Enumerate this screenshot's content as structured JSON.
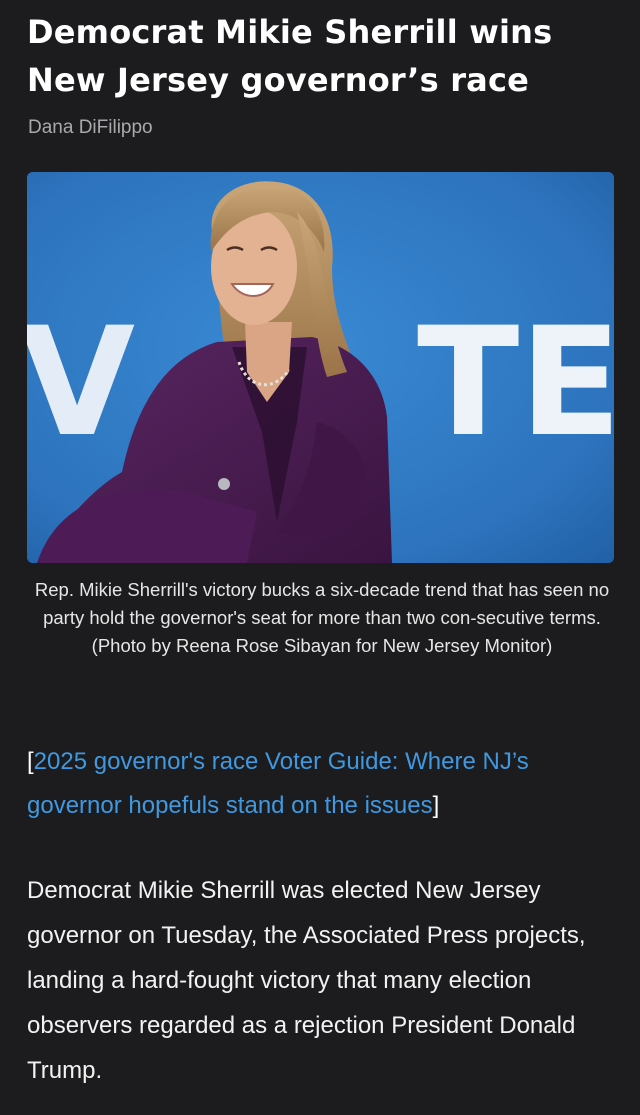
{
  "article": {
    "headline": "Democrat Mikie Sherrill wins New Jersey governor’s race",
    "byline": "Dana DiFilippo",
    "photo": {
      "backdrop_text": "V VOTES",
      "colors": {
        "backdrop": "#2f79c4",
        "suit": "#4a1d52",
        "hair": "#b08a5c"
      }
    },
    "caption": "Rep. Mikie Sherrill's victory bucks a six-decade trend that has seen no party hold the governor's seat for more than two con-secutive terms. (Photo by Reena Rose Sibayan for New Jersey Monitor)",
    "related": {
      "open_bracket": "[",
      "link_text": "2025 governor's race Voter Guide: Where NJ’s governor hopefuls stand on the issues",
      "close_bracket": "]"
    },
    "body": "Democrat Mikie Sherrill was elected New Jersey governor on Tuesday, the Associated Press projects, landing a hard-fought victory that many election observers regarded as a rejection President Donald Trump."
  },
  "colors": {
    "background": "#1c1c1e",
    "link": "#3f99e0",
    "byline": "#a9a9ad"
  }
}
